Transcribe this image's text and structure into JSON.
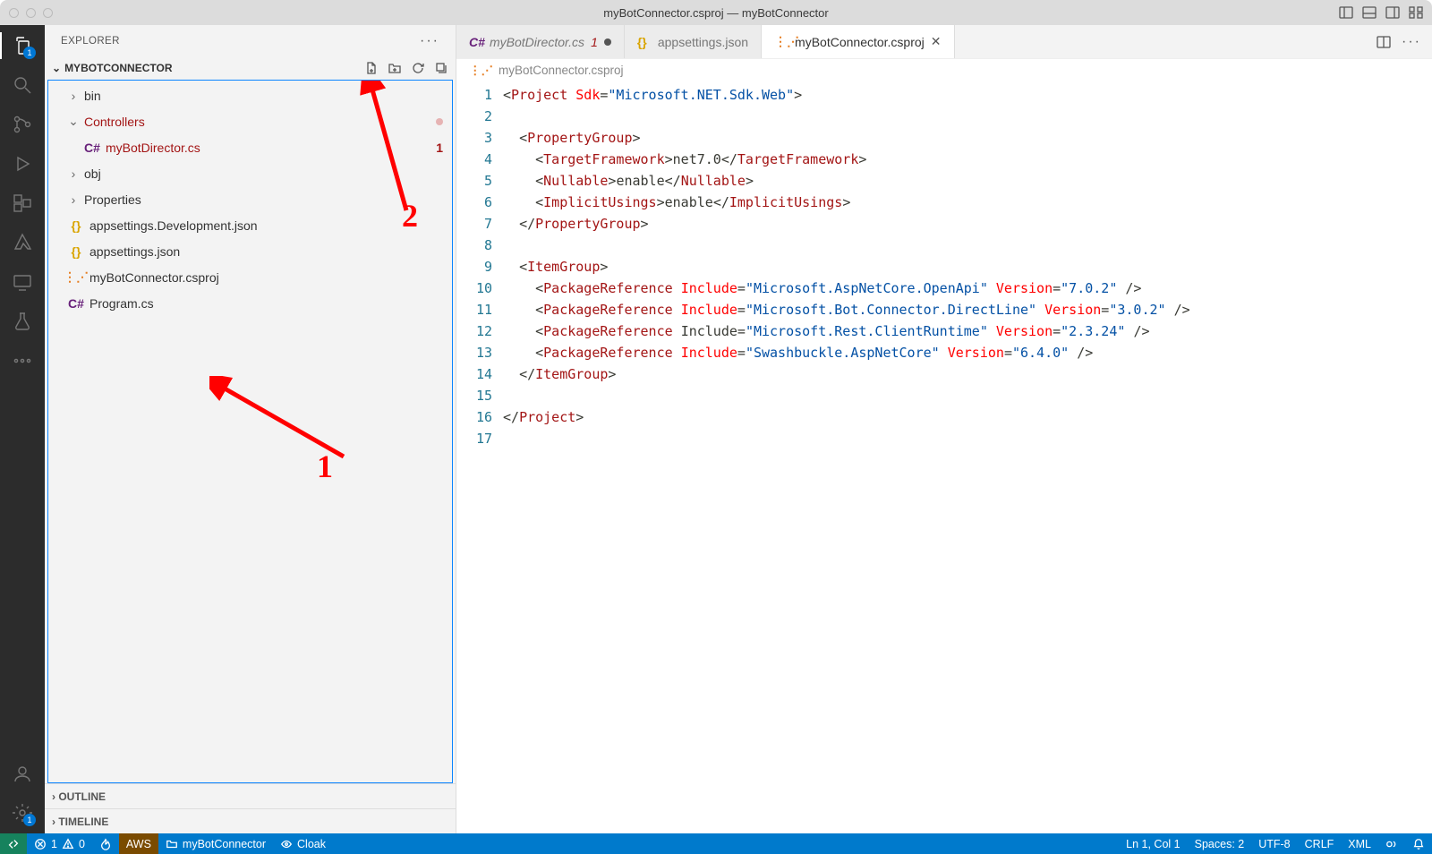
{
  "title": "myBotConnector.csproj — myBotConnector",
  "explorer": {
    "label": "EXPLORER",
    "project": "MYBOTCONNECTOR",
    "outline": "OUTLINE",
    "timeline": "TIMELINE"
  },
  "tree": {
    "bin": "bin",
    "controllers": "Controllers",
    "director": "myBotDirector.cs",
    "director_err": "1",
    "obj": "obj",
    "properties": "Properties",
    "appdev": "appsettings.Development.json",
    "appjson": "appsettings.json",
    "csproj": "myBotConnector.csproj",
    "program": "Program.cs"
  },
  "tabs": {
    "t1": "myBotDirector.cs",
    "t1_err": "1",
    "t2": "appsettings.json",
    "t3": "myBotConnector.csproj"
  },
  "breadcrumb": "myBotConnector.csproj",
  "code": {
    "l1": "<Project Sdk=\"Microsoft.NET.Sdk.Web\">",
    "l3": "  <PropertyGroup>",
    "l4": "    <TargetFramework>net7.0</TargetFramework>",
    "l5": "    <Nullable>enable</Nullable>",
    "l6": "    <ImplicitUsings>enable</ImplicitUsings>",
    "l7": "  </PropertyGroup>",
    "l9": "  <ItemGroup>",
    "l10": "    <PackageReference Include=\"Microsoft.AspNetCore.OpenApi\" Version=\"7.0.2\" />",
    "l11": "    <PackageReference Include=\"Microsoft.Bot.Connector.DirectLine\" Version=\"3.0.2\" />",
    "l12": "    <PackageReference Include=\"Microsoft.Rest.ClientRuntime\" Version=\"2.3.24\" />",
    "l13": "    <PackageReference Include=\"Swashbuckle.AspNetCore\" Version=\"6.4.0\" />",
    "l14": "  </ItemGroup>",
    "l16": "</Project>"
  },
  "annotations": {
    "one": "1",
    "two": "2"
  },
  "status": {
    "errors": "1",
    "warnings": "0",
    "aws": "AWS",
    "folder": "myBotConnector",
    "cloak": "Cloak",
    "pos": "Ln 1, Col 1",
    "spaces": "Spaces: 2",
    "enc": "UTF-8",
    "eol": "CRLF",
    "lang": "XML"
  },
  "activity_badge": "1"
}
